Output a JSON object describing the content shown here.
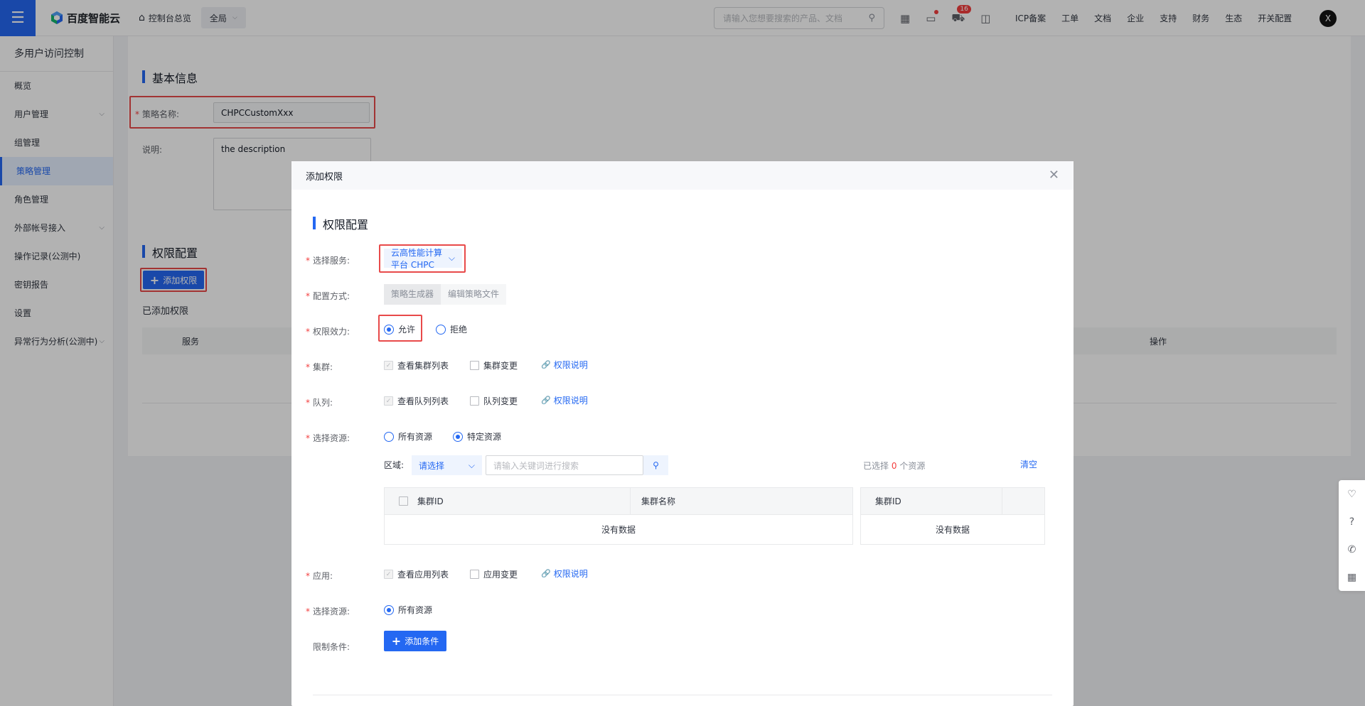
{
  "topbar": {
    "logo": "百度智能云",
    "console_home": "控制台总览",
    "region": "全局",
    "search_placeholder": "请输入您想要搜索的产品、文档",
    "cart_badge": "16",
    "links": [
      "ICP备案",
      "工单",
      "文档",
      "企业",
      "支持",
      "财务",
      "生态",
      "开关配置"
    ],
    "avatar": "X"
  },
  "sidebar": {
    "title": "多用户访问控制",
    "items": [
      {
        "label": "概览"
      },
      {
        "label": "用户管理"
      },
      {
        "label": "组管理"
      },
      {
        "label": "策略管理"
      },
      {
        "label": "角色管理"
      },
      {
        "label": "外部帐号接入"
      },
      {
        "label": "操作记录(公测中)"
      },
      {
        "label": "密钥报告"
      },
      {
        "label": "设置"
      },
      {
        "label": "异常行为分析(公测中)"
      }
    ]
  },
  "main": {
    "basic_info_title": "基本信息",
    "policy_name_label": "策略名称:",
    "policy_name_value": "CHPCCustomXxx",
    "desc_label": "说明:",
    "desc_value": "the description",
    "perm_title": "权限配置",
    "add_perm_button": "添加权限",
    "added_perm_label": "已添加权限",
    "table_headers": {
      "service": "服务",
      "action": "操作"
    }
  },
  "modal": {
    "title": "添加权限",
    "section_title": "权限配置",
    "service_label": "选择服务:",
    "service_value": "云高性能计算平台 CHPC",
    "config_label": "配置方式:",
    "config_options": [
      "策略生成器",
      "编辑策略文件"
    ],
    "effect_label": "权限效力:",
    "effect_allow": "允许",
    "effect_deny": "拒绝",
    "cluster_label": "集群:",
    "cluster_view": "查看集群列表",
    "cluster_change": "集群变更",
    "perm_doc": "权限说明",
    "queue_label": "队列:",
    "queue_view": "查看队列列表",
    "queue_change": "队列变更",
    "resource_label": "选择资源:",
    "resource_all": "所有资源",
    "resource_specific": "特定资源",
    "region_label": "区域:",
    "region_select": "请选择",
    "keyword_placeholder": "请输入关键词进行搜索",
    "selected_prefix": "已选择",
    "selected_count": "0",
    "selected_suffix": "个资源",
    "clear": "清空",
    "left_table_headers": [
      "集群ID",
      "集群名称"
    ],
    "right_table_header": "集群ID",
    "no_data": "没有数据",
    "app_label": "应用:",
    "app_view": "查看应用列表",
    "app_change": "应用变更",
    "resource2_label": "选择资源:",
    "resource2_all": "所有资源",
    "condition_label": "限制条件:",
    "add_condition": "添加条件"
  },
  "colors": {
    "accent": "#2468f2",
    "highlight": "#e84a4a"
  }
}
